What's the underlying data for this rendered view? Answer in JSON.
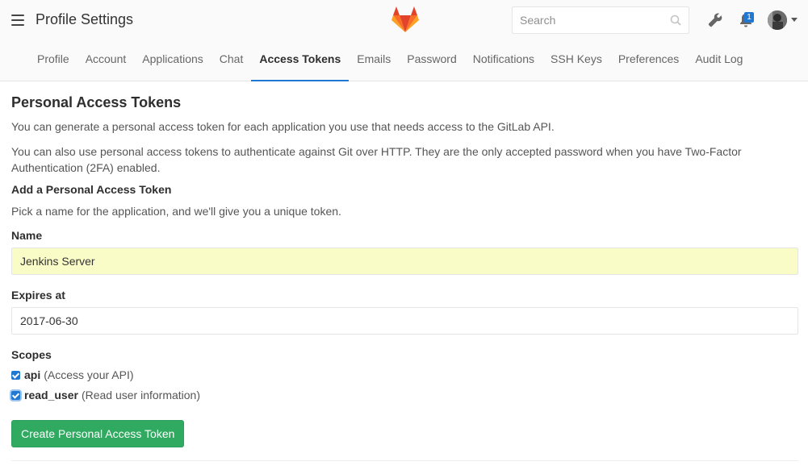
{
  "header": {
    "title": "Profile Settings",
    "search_placeholder": "Search",
    "todo_count": "1"
  },
  "tabs": [
    {
      "label": "Profile"
    },
    {
      "label": "Account"
    },
    {
      "label": "Applications"
    },
    {
      "label": "Chat"
    },
    {
      "label": "Access Tokens",
      "active": true
    },
    {
      "label": "Emails"
    },
    {
      "label": "Password"
    },
    {
      "label": "Notifications"
    },
    {
      "label": "SSH Keys"
    },
    {
      "label": "Preferences"
    },
    {
      "label": "Audit Log"
    }
  ],
  "main": {
    "section_title": "Personal Access Tokens",
    "intro": "You can generate a personal access token for each application you use that needs access to the GitLab API.",
    "intro2_line1": "You can also use personal access tokens to authenticate against Git over HTTP. They are the only accepted password when you have Two-Factor",
    "intro2_line2": "Authentication (2FA) enabled.",
    "add_heading": "Add a Personal Access Token",
    "add_hint": "Pick a name for the application, and we'll give you a unique token.",
    "name_label": "Name",
    "name_value": "Jenkins Server",
    "expires_label": "Expires at",
    "expires_value": "2017-06-30",
    "scopes_label": "Scopes",
    "scopes": [
      {
        "name": "api",
        "desc": "(Access your API)",
        "checked": true
      },
      {
        "name": "read_user",
        "desc": "(Read user information)",
        "checked": true
      }
    ],
    "create_button": "Create Personal Access Token"
  },
  "colors": {
    "accent": "#1f78d1",
    "create_button": "#2faa60",
    "autofill_bg": "#fafcc8",
    "logo_orange": "#e24329"
  },
  "icons": [
    "hamburger-icon",
    "gitlab-logo",
    "search-icon",
    "wrench-icon",
    "bell-icon",
    "avatar",
    "caret-down-icon",
    "checkbox-checked-icon"
  ]
}
